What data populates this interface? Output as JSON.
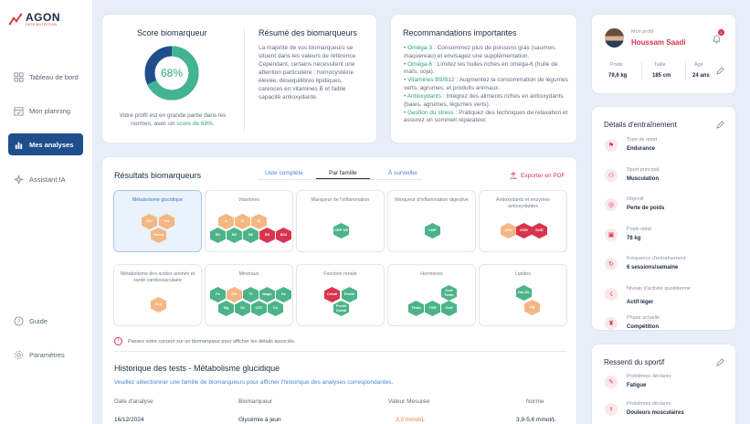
{
  "brand": {
    "name": "AGON",
    "sub": "DATA NUTRITION"
  },
  "nav": [
    {
      "label": "Tableau de bord"
    },
    {
      "label": "Mon planning"
    },
    {
      "label": "Mes analyses"
    },
    {
      "label": "Assistant IA"
    }
  ],
  "nav_bottom": [
    {
      "label": "Guide"
    },
    {
      "label": "Paramètres"
    }
  ],
  "score": {
    "title": "Score biomarqueur",
    "value": "68%",
    "percent": 68,
    "text1": "Votre profil est en grande partie dans les normes, avec un",
    "text2": "score de 68%.",
    "colors": {
      "good": "#42b48f",
      "rest": "#1f4e8c"
    }
  },
  "summary": {
    "title": "Résumé des biomarqueurs",
    "text": "La majorité de vos biomarqueurs se situent dans les valeurs de référence. Cependant, certains nécessitent une attention particulière : homocystéine élevée, déséquilibres lipidiques, carences en vitamines B et faible capacité antioxydante."
  },
  "reco": {
    "title": "Recommandations importantes",
    "items": [
      {
        "k": "Oméga-3",
        "t": " : Consommez plus de poissons gras (saumon, maquereau) et envisagez une supplémentation."
      },
      {
        "k": "Oméga-6",
        "t": " : Limitez les huiles riches en oméga-6 (huile de maïs, soja)."
      },
      {
        "k": "Vitamines B9/B12",
        "t": " : Augmentez la consommation de légumes verts, agrumes, et produits animaux."
      },
      {
        "k": "Antioxydants",
        "t": " : Intégrez des aliments riches en antioxydants (baies, agrumes, légumes verts)."
      },
      {
        "k": "Gestion du stress",
        "t": " : Pratiquez des techniques de relaxation et assurez un sommeil réparateur."
      }
    ]
  },
  "results": {
    "title": "Résultats biomarqueurs",
    "tabs": [
      "Liste complète",
      "Par famille",
      "À surveiller"
    ],
    "export": "Exporter en PDF",
    "hint": "Passez votre curseur sur un biomarqueur pour afficher les détails associés.",
    "families": [
      {
        "label": "Métabolisme glucidique",
        "hex": [
          "Glu",
          "Ins",
          "Homa"
        ]
      },
      {
        "label": "Vitamines",
        "hex": [
          "A",
          "D",
          "E",
          "B1",
          "B2",
          "B6",
          "B9",
          "B12"
        ]
      },
      {
        "label": "Marqueur de l'inflammation",
        "hex": [
          "CRP US"
        ]
      },
      {
        "label": "Marqueur d'inflammation digestive",
        "hex": [
          "LBP"
        ]
      },
      {
        "label": "Antioxydants et enzymes antioxydantes",
        "hex": [
          "GPx",
          "GSH",
          "SOD"
        ]
      },
      {
        "label": "Métabolisme des acides aminés et santé cardiovasculaire",
        "hex": [
          "Hcy"
        ]
      },
      {
        "label": "Minéraux",
        "hex": [
          "Fe",
          "Fer",
          "Tf",
          "Magn",
          "Se",
          "Mg",
          "Zn",
          "CST",
          "Cu"
        ]
      },
      {
        "label": "Fonction rénale",
        "hex": [
          "Créati",
          "Protéi",
          "Protéi Créati"
        ]
      },
      {
        "label": "Hormones",
        "hex": [
          "Cort Testo",
          "Testo",
          "TSH",
          "Cort"
        ]
      },
      {
        "label": "Lipides",
        "hex": [
          "DsLDL",
          "Ag"
        ]
      }
    ]
  },
  "history": {
    "title": "Historique des tests - Métabolisme glucidique",
    "subtitle": "Veuillez sélectionner une famille de biomarqueurs pour afficher l'historique des analyses correspondantes.",
    "columns": [
      "Date d'analyse",
      "Biomarqueur",
      "Valeur Mesurée",
      "Norme"
    ],
    "rows": [
      {
        "date": "16/12/2024",
        "bio": "Glycémie à jeun",
        "val": "3,9 mmol/L",
        "norme": "3,9-5,6 mmol/L"
      }
    ]
  },
  "profile": {
    "label": "Mon profil",
    "name": "Houssam Saadi",
    "notif": "1",
    "stats": [
      {
        "k": "Poids",
        "v": "79,6 kg"
      },
      {
        "k": "Taille",
        "v": "185 cm"
      },
      {
        "k": "Âge",
        "v": "24 ans"
      }
    ]
  },
  "training": {
    "title": "Détails d'entraînement",
    "items": [
      {
        "k": "Type de sport",
        "v": "Endurance"
      },
      {
        "k": "Sport principal",
        "v": "Musculation"
      },
      {
        "k": "Objectif",
        "v": "Perte de poids"
      },
      {
        "k": "Poids idéal",
        "v": "78 kg"
      },
      {
        "k": "Fréquence d'entraînement",
        "v": "6 sessions/semaine"
      },
      {
        "k": "Niveau d'activité quotidienne",
        "v": "Actif léger"
      },
      {
        "k": "Phase actuelle",
        "v": "Compétition"
      }
    ]
  },
  "feeling": {
    "title": "Ressenti du sportif",
    "items": [
      {
        "k": "Problèmes déclarés",
        "v": "Fatigue"
      },
      {
        "k": "Problèmes déclarés",
        "v": "Douleurs musculaires"
      }
    ]
  }
}
